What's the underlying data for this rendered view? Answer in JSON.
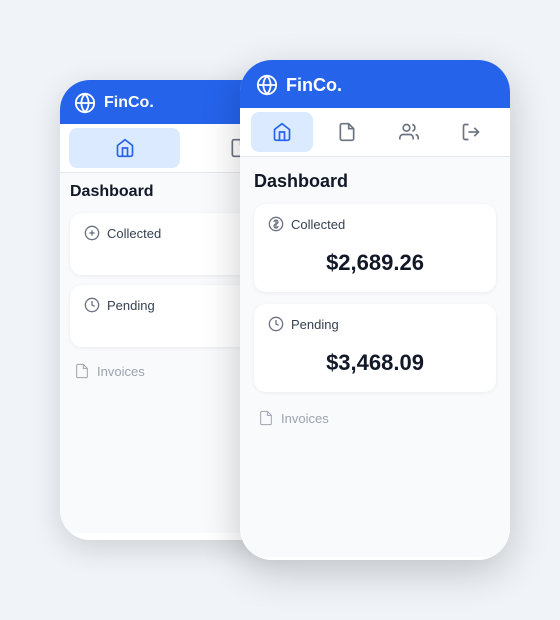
{
  "app": {
    "name": "FinCo.",
    "logo_label": "globe-icon"
  },
  "nav": {
    "tabs": [
      {
        "id": "home",
        "label": "Home",
        "icon": "home-icon",
        "active": true
      },
      {
        "id": "documents",
        "label": "Documents",
        "icon": "documents-icon",
        "active": false
      },
      {
        "id": "users",
        "label": "Users",
        "icon": "users-icon",
        "active": false
      },
      {
        "id": "logout",
        "label": "Logout",
        "icon": "logout-icon",
        "active": false
      }
    ]
  },
  "dashboard": {
    "title": "Dashboard",
    "collected": {
      "label": "Collected",
      "value": "$2,689.26"
    },
    "pending": {
      "label": "Pending",
      "value": "$3,468.09"
    },
    "invoices": {
      "label": "Invoices"
    }
  }
}
